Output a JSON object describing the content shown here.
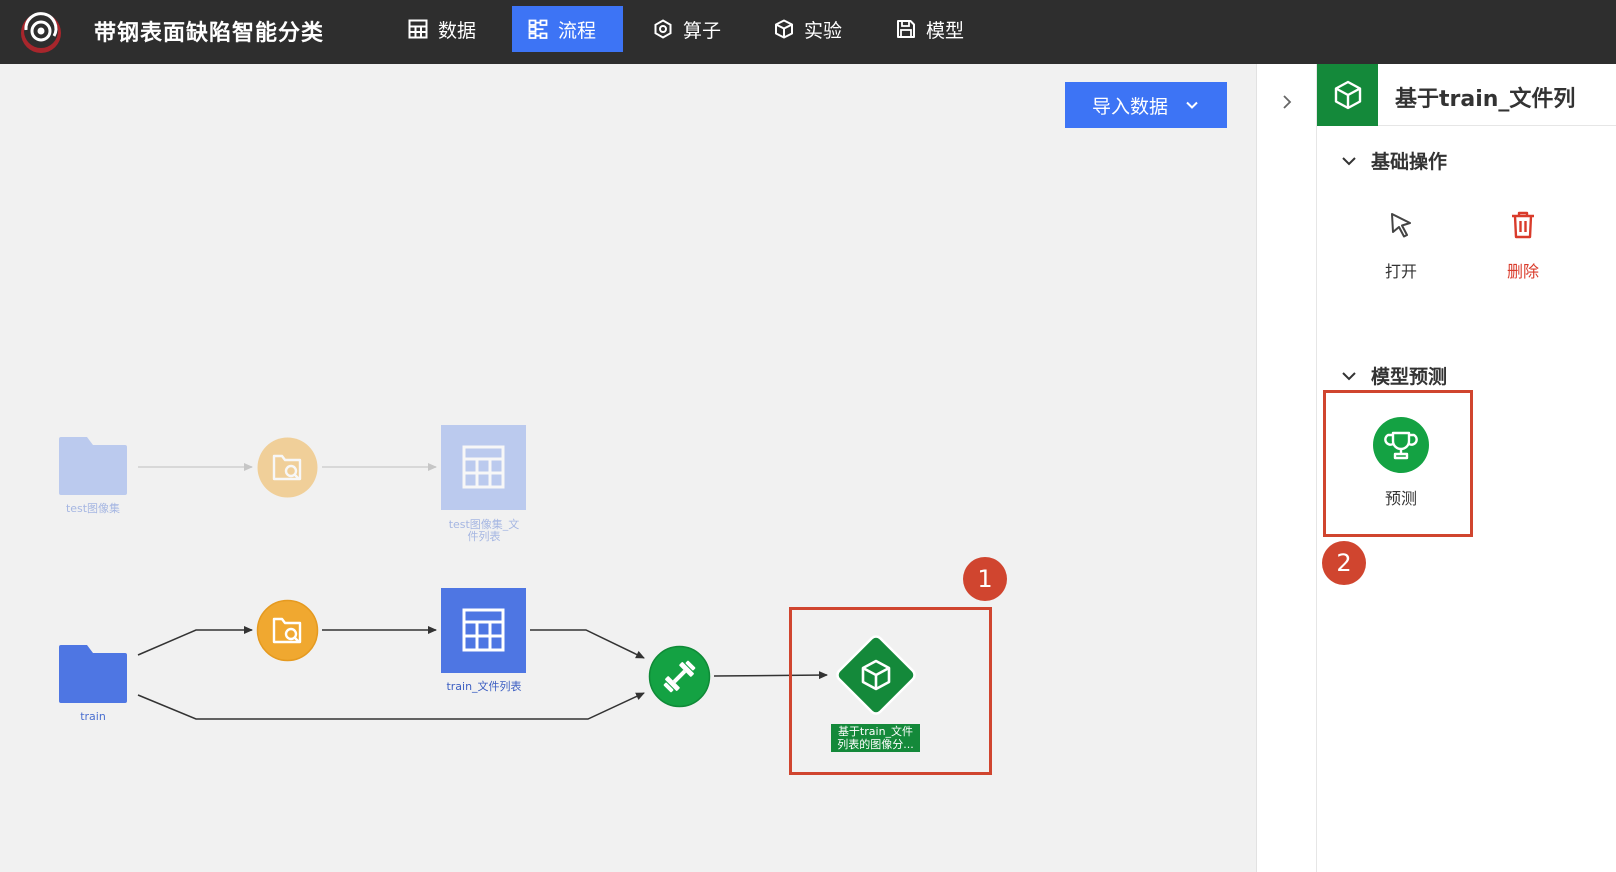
{
  "header": {
    "title": "带钢表面缺陷智能分类",
    "nav": [
      {
        "label": "数据",
        "icon": "grid-icon",
        "active": false
      },
      {
        "label": "流程",
        "icon": "flow-icon",
        "active": true
      },
      {
        "label": "算子",
        "icon": "hexagon-icon",
        "active": false
      },
      {
        "label": "实验",
        "icon": "cube-icon",
        "active": false
      },
      {
        "label": "模型",
        "icon": "floppy-icon",
        "active": false
      }
    ]
  },
  "canvas": {
    "import_button": "导入数据",
    "nodes": {
      "test_folder": "test图像集",
      "test_table_line1": "test图像集_文",
      "test_table_line2": "件列表",
      "train_folder": "train",
      "train_table": "train_文件列表",
      "model_line1": "基于train_文件",
      "model_line2": "列表的图像分..."
    },
    "badges": {
      "first": "1",
      "second": "2"
    }
  },
  "panel": {
    "title": "基于train_文件列",
    "sections": [
      {
        "title": "基础操作",
        "actions": [
          {
            "label": "打开"
          },
          {
            "label": "删除"
          }
        ]
      },
      {
        "title": "模型预测",
        "actions": [
          {
            "label": "预测"
          }
        ]
      }
    ]
  },
  "colors": {
    "topbar": "#2e2e2e",
    "accent": "#3d74f5",
    "green": "#14893a",
    "orange": "#f0a830",
    "highlight": "#d0452f",
    "delete": "#d93b2b"
  }
}
